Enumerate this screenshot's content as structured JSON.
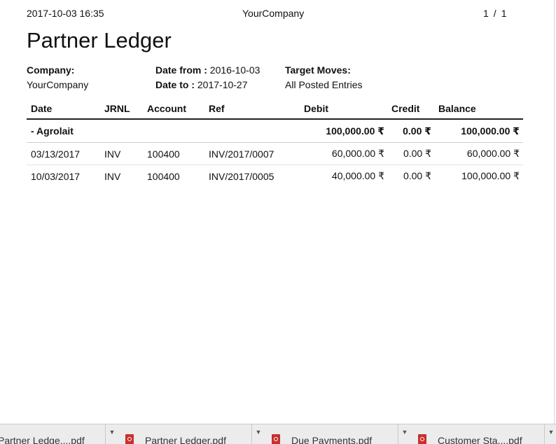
{
  "header": {
    "timestamp": "2017-10-03 16:35",
    "company": "YourCompany",
    "page_current": "1",
    "page_sep": "/",
    "page_total": "1"
  },
  "report": {
    "title": "Partner Ledger",
    "company_label": "Company:",
    "company_value": "YourCompany",
    "date_from_label": "Date from :",
    "date_from_value": "2016-10-03",
    "date_to_label": "Date to :",
    "date_to_value": "2017-10-27",
    "target_moves_label": "Target Moves:",
    "target_moves_value": "All Posted Entries"
  },
  "table": {
    "columns": [
      "Date",
      "JRNL",
      "Account",
      "Ref",
      "Debit",
      "Credit",
      "Balance"
    ],
    "group": {
      "name": "- Agrolait",
      "debit": "100,000.00 ₹",
      "credit": "0.00 ₹",
      "balance": "100,000.00 ₹"
    },
    "rows": [
      {
        "date": "03/13/2017",
        "jrnl": "INV",
        "account": "100400",
        "ref": "INV/2017/0007",
        "debit": "60,000.00 ₹",
        "credit": "0.00 ₹",
        "balance": "60,000.00 ₹"
      },
      {
        "date": "10/03/2017",
        "jrnl": "INV",
        "account": "100400",
        "ref": "INV/2017/0005",
        "debit": "40,000.00 ₹",
        "credit": "0.00 ₹",
        "balance": "100,000.00 ₹"
      }
    ]
  },
  "downloads": {
    "items": [
      {
        "label": "Partner Ledge....pdf",
        "icon": "pdf-file-icon"
      },
      {
        "label": "Partner Ledger.pdf",
        "icon": "pdf-file-icon"
      },
      {
        "label": "Due Payments.pdf",
        "icon": "pdf-file-icon"
      },
      {
        "label": "Customer Sta....pdf",
        "icon": "pdf-file-icon"
      }
    ]
  }
}
